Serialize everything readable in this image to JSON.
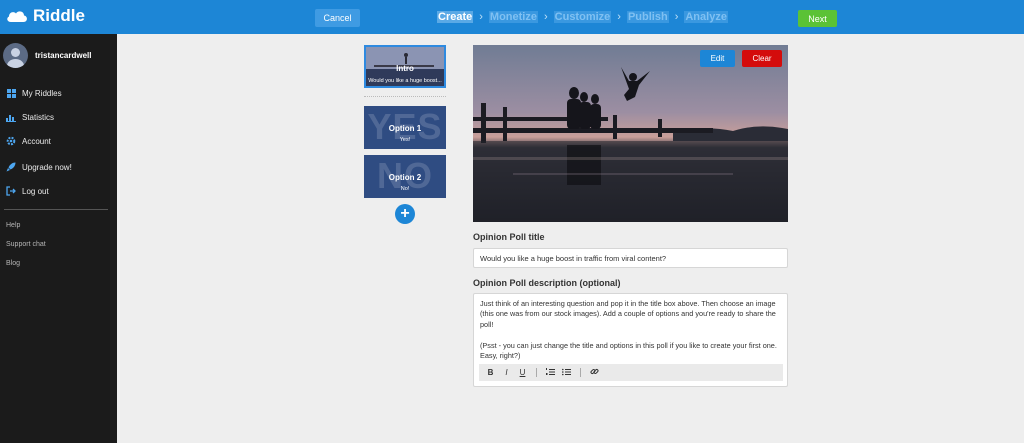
{
  "app": {
    "brand": "Riddle"
  },
  "topbar": {
    "cancel_label": "Cancel",
    "next_label": "Next",
    "steps": [
      "Create",
      "Monetize",
      "Customize",
      "Publish",
      "Analyze"
    ],
    "step_separator": "›",
    "active_step": "Create",
    "colors": {
      "bar": "#1d86d6",
      "next": "#5bc236"
    }
  },
  "sidebar": {
    "username": "tristancardwell",
    "items": [
      {
        "label": "My Riddles",
        "icon": "grid-icon"
      },
      {
        "label": "Statistics",
        "icon": "bar-chart-icon"
      },
      {
        "label": "Account",
        "icon": "gear-icon"
      },
      {
        "label": "Upgrade now!",
        "icon": "rocket-icon"
      },
      {
        "label": "Log out",
        "icon": "logout-icon"
      }
    ],
    "minor_links": [
      "Help",
      "Support chat",
      "Blog"
    ]
  },
  "thumbnails": {
    "intro": {
      "title": "Intro",
      "subtitle": "Would you like a huge boost..."
    },
    "options": [
      {
        "title": "Option 1",
        "subtitle": "Yes!",
        "watermark": "YES"
      },
      {
        "title": "Option 2",
        "subtitle": "No!",
        "watermark": "NO"
      }
    ],
    "add_label": "+"
  },
  "image": {
    "edit_label": "Edit",
    "clear_label": "Clear"
  },
  "form": {
    "title_label": "Opinion Poll title",
    "title_value": "Would you like a huge boost in traffic from viral content?",
    "description_label": "Opinion Poll description (optional)",
    "description_para1": "Just think of an interesting question and pop it in the title box above. Then choose an image (this one was from our stock images). Add a couple of options and you're ready to share the poll!",
    "description_para2": "(Psst - you can just change the title and options in this poll if you like to create your first one. Easy, right?)",
    "toolbar": {
      "bold": "B",
      "italic": "I",
      "underline": "U"
    }
  }
}
